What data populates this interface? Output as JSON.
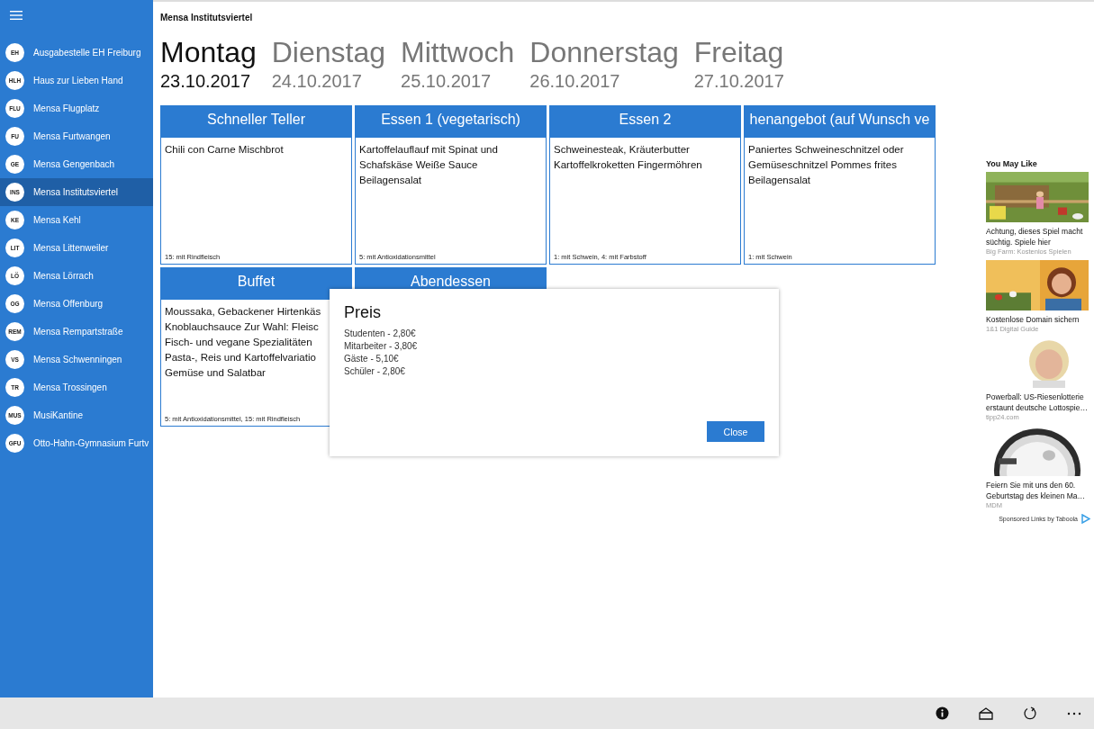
{
  "sidebar": {
    "items": [
      {
        "abbr": "EH",
        "label": "Ausgabestelle EH Freiburg",
        "selected": false
      },
      {
        "abbr": "HLH",
        "label": "Haus zur Lieben Hand",
        "selected": false
      },
      {
        "abbr": "FLU",
        "label": "Mensa Flugplatz",
        "selected": false
      },
      {
        "abbr": "FU",
        "label": "Mensa Furtwangen",
        "selected": false
      },
      {
        "abbr": "GE",
        "label": "Mensa Gengenbach",
        "selected": false
      },
      {
        "abbr": "INS",
        "label": "Mensa Institutsviertel",
        "selected": true
      },
      {
        "abbr": "KE",
        "label": "Mensa Kehl",
        "selected": false
      },
      {
        "abbr": "LIT",
        "label": "Mensa Littenweiler",
        "selected": false
      },
      {
        "abbr": "LÖ",
        "label": "Mensa Lörrach",
        "selected": false
      },
      {
        "abbr": "OG",
        "label": "Mensa Offenburg",
        "selected": false
      },
      {
        "abbr": "REM",
        "label": "Mensa Rempartstraße",
        "selected": false
      },
      {
        "abbr": "VS",
        "label": "Mensa Schwenningen",
        "selected": false
      },
      {
        "abbr": "TR",
        "label": "Mensa Trossingen",
        "selected": false
      },
      {
        "abbr": "MUS",
        "label": "MusiKantine",
        "selected": false
      },
      {
        "abbr": "GFU",
        "label": "Otto-Hahn-Gymnasium Furtv",
        "selected": false
      }
    ]
  },
  "page_title": "Mensa Institutsviertel",
  "days": [
    {
      "name": "Montag",
      "date": "23.10.2017",
      "selected": true
    },
    {
      "name": "Dienstag",
      "date": "24.10.2017",
      "selected": false
    },
    {
      "name": "Mittwoch",
      "date": "25.10.2017",
      "selected": false
    },
    {
      "name": "Donnerstag",
      "date": "26.10.2017",
      "selected": false
    },
    {
      "name": "Freitag",
      "date": "27.10.2017",
      "selected": false
    }
  ],
  "meals": [
    {
      "title": "Schneller Teller",
      "description": "Chili con Carne Mischbrot",
      "notes": "15: mit Rindfleisch"
    },
    {
      "title": "Essen 1 (vegetarisch)",
      "description": "Kartoffelauflauf mit Spinat und Schafskäse Weiße Sauce Beilagensalat",
      "notes": "5: mit Antioxidationsmittel"
    },
    {
      "title": "Essen 2",
      "description": "Schweinesteak, Kräuterbutter Kartoffelkroketten Fingermöhren",
      "notes": "1: mit Schwein, 4: mit Farbstoff"
    },
    {
      "title": "henangebot (auf Wunsch ve",
      "description": "Paniertes Schweineschnitzel oder Gemüseschnitzel Pommes frites Beilagensalat",
      "notes": "1: mit Schwein"
    },
    {
      "title": "Buffet",
      "description": "Moussaka, Gebackener Hirtenkäs\nKnoblauchsauce Zur Wahl: Fleisc\nFisch- und vegane Spezialitäten\nPasta-, Reis und Kartoffelvariatio\nGemüse und Salatbar",
      "notes": "5: mit Antioxidationsmittel, 15: mit Rindfleisch"
    },
    {
      "title": "Abendessen"
    }
  ],
  "dialog": {
    "title": "Preis",
    "lines": [
      "Studenten - 2,80€",
      "Mitarbeiter - 3,80€",
      "Gäste - 5,10€",
      "Schüler - 2,80€"
    ],
    "button": "Close"
  },
  "ads": {
    "heading": "You May Like",
    "items": [
      {
        "kind": "picture",
        "title": "Achtung, dieses Spiel macht süchtig. Spiele hier",
        "source": "Big Farm: Kostenlos Spielen"
      },
      {
        "kind": "picture",
        "title": "Kostenlose Domain sichern",
        "source": "1&1 Digital Guide"
      },
      {
        "kind": "picture",
        "title": "Powerball: US-Riesenlotterie erstaunt deutsche Lottospie…",
        "source": "tipp24.com"
      },
      {
        "kind": "picture",
        "title": "Feiern Sie mit uns den 60. Geburtstag des kleinen Ma…",
        "source": "MDM"
      }
    ],
    "footer": "Sponsored Links by Taboola"
  }
}
